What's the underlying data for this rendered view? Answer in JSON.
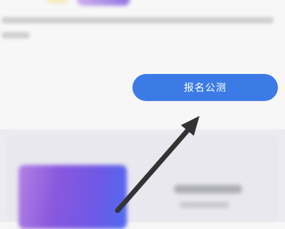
{
  "signup_button": {
    "label": "报名公测"
  },
  "colors": {
    "button_bg": "#3c7be6",
    "button_text": "#ffffff",
    "arrow": "#333333",
    "page_bg": "#f6f6f6"
  },
  "icons": {
    "annotation": "arrow-icon"
  }
}
